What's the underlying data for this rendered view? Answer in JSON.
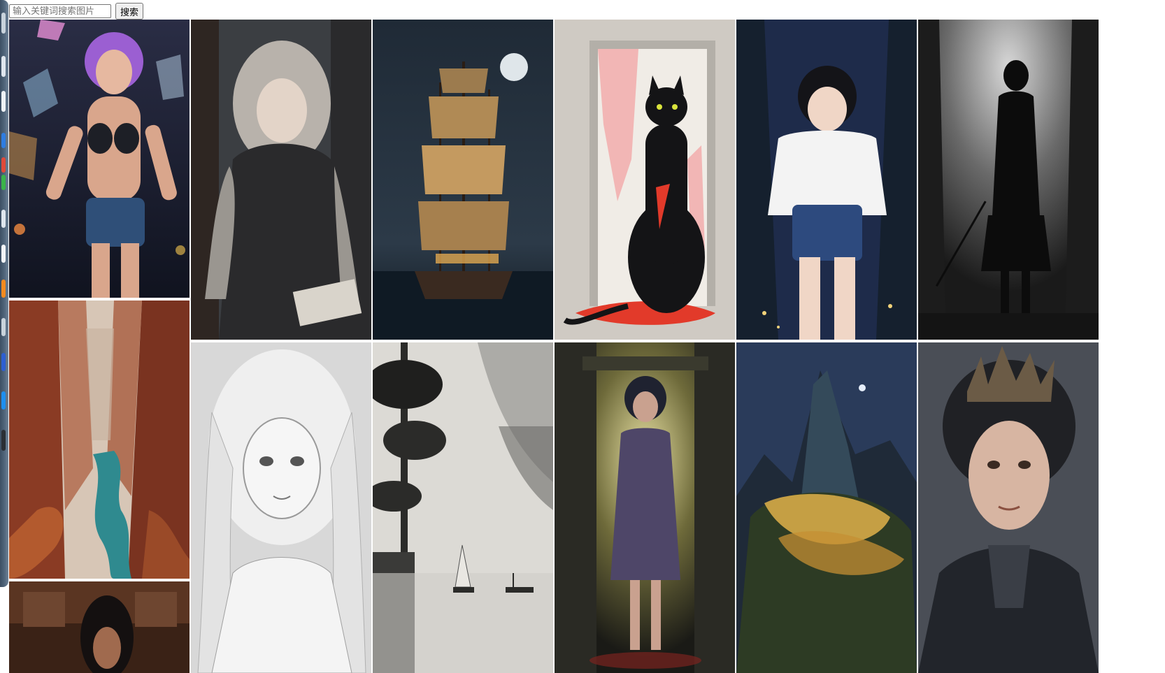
{
  "search": {
    "placeholder": "输入关键词搜索图片",
    "value": "",
    "button_label": "搜索"
  },
  "gallery": {
    "images": [
      {
        "id": "purple-hair-woman",
        "subject": "woman-with-purple-hair-and-crystals"
      },
      {
        "id": "gray-hair-girl-reading",
        "subject": "anime-girl-gray-hair-reading"
      },
      {
        "id": "sailing-ship-moon",
        "subject": "sailing-ship-at-night-full-moon"
      },
      {
        "id": "black-cat-door",
        "subject": "black-cat-in-doorway-red-paint"
      },
      {
        "id": "girl-white-shirt-forest",
        "subject": "anime-girl-white-shirt-night-forest"
      },
      {
        "id": "silhouette-sword",
        "subject": "silhouette-with-sword-dark-forest"
      },
      {
        "id": "canyon-river",
        "subject": "red-canyon-with-river"
      },
      {
        "id": "sketch-girl",
        "subject": "pencil-sketch-anime-girl"
      },
      {
        "id": "ink-landscape-boats",
        "subject": "misty-ink-landscape-with-boats"
      },
      {
        "id": "girl-corridor",
        "subject": "girl-in-dark-corridor"
      },
      {
        "id": "mountain-village-night",
        "subject": "mountain-village-at-night"
      },
      {
        "id": "woman-crown",
        "subject": "woman-with-dark-crown"
      },
      {
        "id": "woman-temple",
        "subject": "woman-dark-hair-temple"
      }
    ]
  }
}
